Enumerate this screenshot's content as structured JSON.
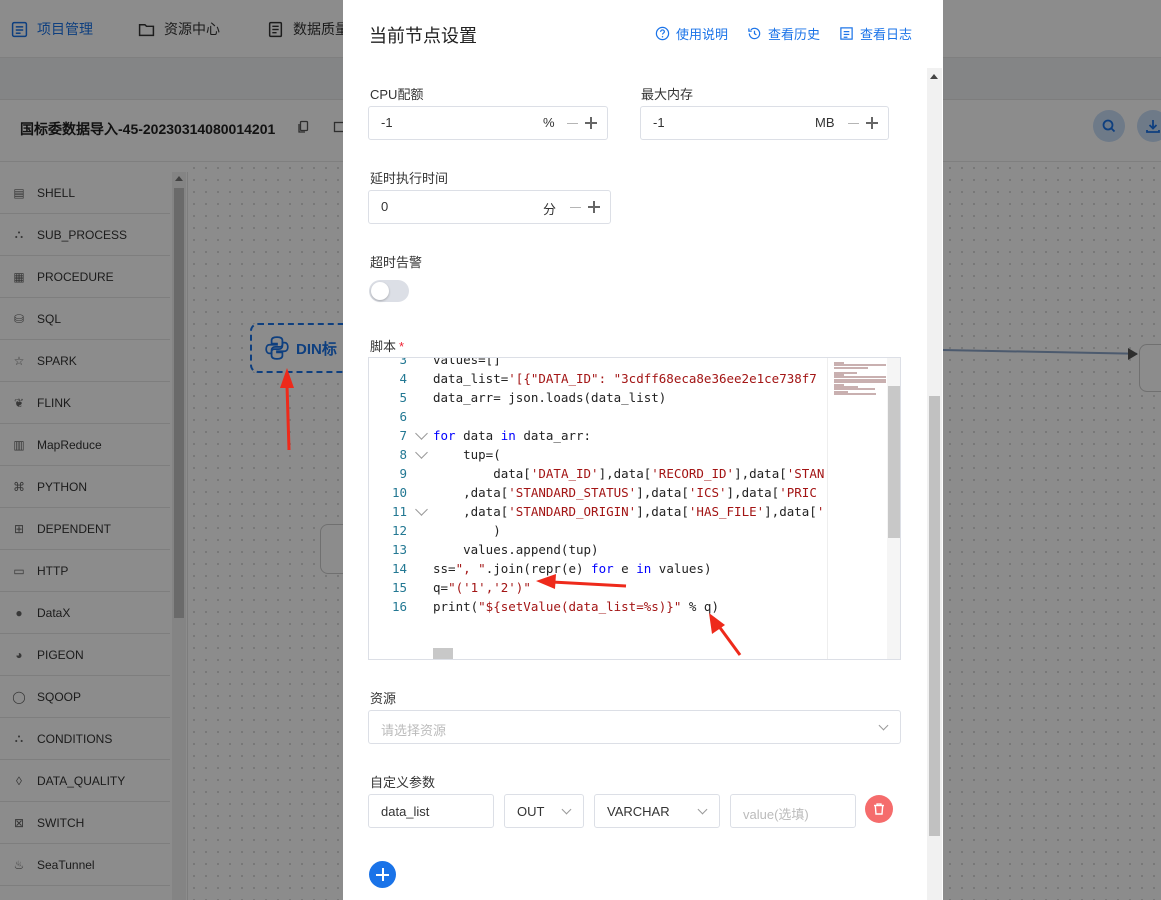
{
  "topnav": {
    "items": [
      {
        "label": "项目管理",
        "icon": "project-icon",
        "active": true
      },
      {
        "label": "资源中心",
        "icon": "folder-icon"
      },
      {
        "label": "数据质量",
        "icon": "document-icon"
      }
    ]
  },
  "workflow": {
    "title": "国标委数据导入-45-20230314080014201"
  },
  "palette": {
    "items": [
      {
        "label": "SHELL",
        "icon": "shell-icon"
      },
      {
        "label": "SUB_PROCESS",
        "icon": "sub-process-icon"
      },
      {
        "label": "PROCEDURE",
        "icon": "procedure-icon"
      },
      {
        "label": "SQL",
        "icon": "sql-icon"
      },
      {
        "label": "SPARK",
        "icon": "spark-icon"
      },
      {
        "label": "FLINK",
        "icon": "flink-icon"
      },
      {
        "label": "MapReduce",
        "icon": "mapreduce-icon"
      },
      {
        "label": "PYTHON",
        "icon": "python-icon"
      },
      {
        "label": "DEPENDENT",
        "icon": "dependent-icon"
      },
      {
        "label": "HTTP",
        "icon": "http-icon"
      },
      {
        "label": "DataX",
        "icon": "datax-icon"
      },
      {
        "label": "PIGEON",
        "icon": "pigeon-icon"
      },
      {
        "label": "SQOOP",
        "icon": "sqoop-icon"
      },
      {
        "label": "CONDITIONS",
        "icon": "conditions-icon"
      },
      {
        "label": "DATA_QUALITY",
        "icon": "data-quality-icon"
      },
      {
        "label": "SWITCH",
        "icon": "switch-icon"
      },
      {
        "label": "SeaTunnel",
        "icon": "seatunnel-icon"
      }
    ]
  },
  "canvas": {
    "node_label": "DIN标"
  },
  "drawer": {
    "title": "当前节点设置",
    "links": {
      "help": "使用说明",
      "history": "查看历史",
      "log": "查看日志"
    },
    "cpu": {
      "label": "CPU配额",
      "value": "-1",
      "unit": "%"
    },
    "memory": {
      "label": "最大内存",
      "value": "-1",
      "unit": "MB"
    },
    "delay": {
      "label": "延时执行时间",
      "value": "0",
      "unit": "分"
    },
    "timeout": {
      "label": "超时告警",
      "enabled": false
    },
    "script": {
      "label": "脚本",
      "required_mark": "*"
    },
    "resource": {
      "label": "资源",
      "placeholder": "请选择资源"
    },
    "params": {
      "label": "自定义参数",
      "rows": [
        {
          "prop": "data_list",
          "direct": "OUT",
          "type": "VARCHAR",
          "value_placeholder": "value(选填)"
        }
      ]
    }
  },
  "code": {
    "lines": [
      {
        "n": "3",
        "text": "values=[]"
      },
      {
        "n": "4",
        "text": "data_list='[{\"DATA_ID\": \"3cdff68eca8e36ee2e1ce738f7"
      },
      {
        "n": "5",
        "text": "data_arr= json.loads(data_list)"
      },
      {
        "n": "6",
        "text": ""
      },
      {
        "n": "7",
        "text": "for data in data_arr:"
      },
      {
        "n": "8",
        "text": "    tup=("
      },
      {
        "n": "9",
        "text": "        data['DATA_ID'],data['RECORD_ID'],data['STAN"
      },
      {
        "n": "10",
        "text": "    ,data['STANDARD_STATUS'],data['ICS'],data['PRIC"
      },
      {
        "n": "11",
        "text": "    ,data['STANDARD_ORIGIN'],data['HAS_FILE'],data['"
      },
      {
        "n": "12",
        "text": "        )"
      },
      {
        "n": "13",
        "text": "    values.append(tup)"
      },
      {
        "n": "14",
        "text": "ss=\", \".join(repr(e) for e in values)"
      },
      {
        "n": "15",
        "text": "q=\"('1','2')\""
      },
      {
        "n": "16",
        "text": "print(\"${setValue(data_list=%s)}\" % q)"
      }
    ]
  }
}
